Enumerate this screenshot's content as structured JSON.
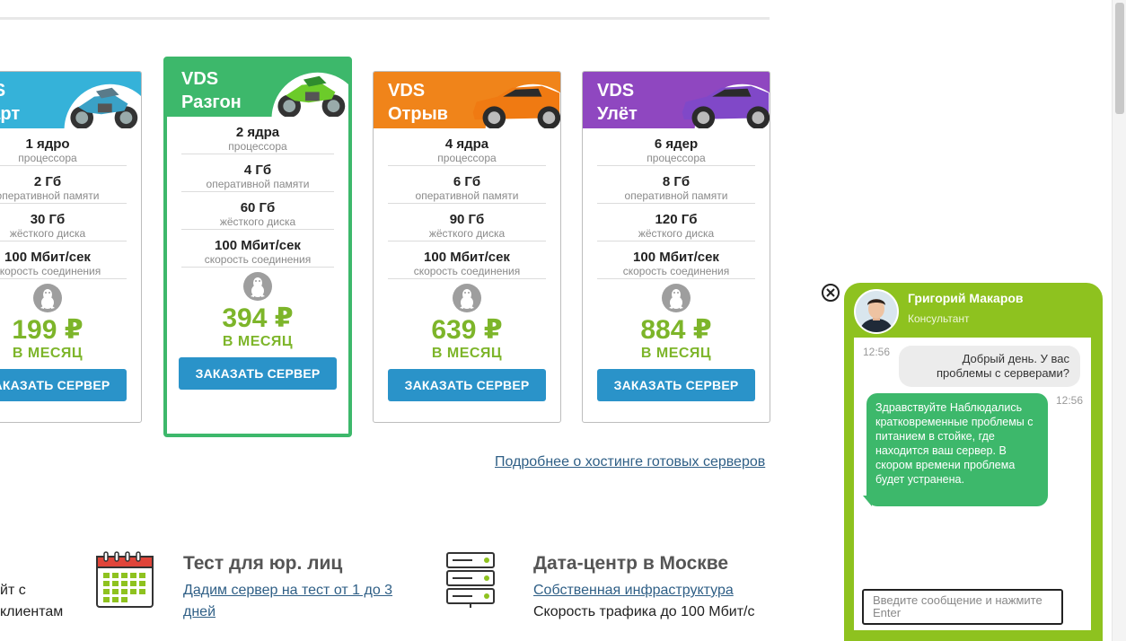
{
  "plans": [
    {
      "title": "VDS\nСтарт",
      "color": "#35b2d9",
      "specs": [
        {
          "value": "1 ядро",
          "label": "процессора"
        },
        {
          "value": "2 Гб",
          "label": "оперативной памяти"
        },
        {
          "value": "30 Гб",
          "label": "жёсткого диска"
        },
        {
          "value": "100 Мбит/сек",
          "label": "скорость соединения"
        }
      ],
      "price": "199 ₽",
      "period": "В МЕСЯЦ",
      "button": "ЗАКАЗАТЬ СЕРВЕР"
    },
    {
      "title": "VDS\nРазгон",
      "color": "#3db86b",
      "specs": [
        {
          "value": "2 ядра",
          "label": "процессора"
        },
        {
          "value": "4 Гб",
          "label": "оперативной памяти"
        },
        {
          "value": "60 Гб",
          "label": "жёсткого диска"
        },
        {
          "value": "100 Мбит/сек",
          "label": "скорость соединения"
        }
      ],
      "price": "394 ₽",
      "period": "В МЕСЯЦ",
      "button": "ЗАКАЗАТЬ СЕРВЕР"
    },
    {
      "title": "VDS\nОтрыв",
      "color": "#f0841a",
      "specs": [
        {
          "value": "4 ядра",
          "label": "процессора"
        },
        {
          "value": "6 Гб",
          "label": "оперативной памяти"
        },
        {
          "value": "90 Гб",
          "label": "жёсткого диска"
        },
        {
          "value": "100 Мбит/сек",
          "label": "скорость соединения"
        }
      ],
      "price": "639 ₽",
      "period": "В МЕСЯЦ",
      "button": "ЗАКАЗАТЬ СЕРВЕР"
    },
    {
      "title": "VDS\nУлёт",
      "color": "#8f47c0",
      "specs": [
        {
          "value": "6 ядер",
          "label": "процессора"
        },
        {
          "value": "8 Гб",
          "label": "оперативной памяти"
        },
        {
          "value": "120 Гб",
          "label": "жёсткого диска"
        },
        {
          "value": "100 Мбит/сек",
          "label": "скорость соединения"
        }
      ],
      "price": "884 ₽",
      "period": "В МЕСЯЦ",
      "button": "ЗАКАЗАТЬ СЕРВЕР"
    }
  ],
  "more_link": "Подробнее о хостинге готовых серверов",
  "features": {
    "partial_line1": "йт с",
    "partial_line2": "клиентам",
    "test": {
      "title": "Тест для юр. лиц",
      "link_line1": "Дадим сервер на тест от 1 до 3",
      "link_line2": "дней"
    },
    "datacenter": {
      "title": "Дата-центр в Москве",
      "link": "Собственная инфраструктура",
      "text": "Скорость трафика до 100 Мбит/с"
    }
  },
  "chat": {
    "agent_name": "Григорий Макаров",
    "agent_role": "Консультант",
    "messages": [
      {
        "time": "12:56",
        "text": "Добрый день. У вас проблемы с серверами?"
      },
      {
        "time": "12:56",
        "text": "Здравствуйте Наблюдались кратковременные проблемы с питанием в стойке, где находится ваш сервер. В скором времени проблема будет устранена."
      }
    ],
    "input_placeholder": "Введите сообщение и нажмите Enter"
  },
  "colors": {
    "accent_green": "#3db86b",
    "price_green": "#7db52a",
    "button_blue": "#2a93c9",
    "chat_green": "#8ec21f"
  },
  "icons": [
    "linux-icon",
    "calendar-icon",
    "server-rack-icon",
    "close-icon",
    "motorcycle-icon",
    "car-icon"
  ]
}
